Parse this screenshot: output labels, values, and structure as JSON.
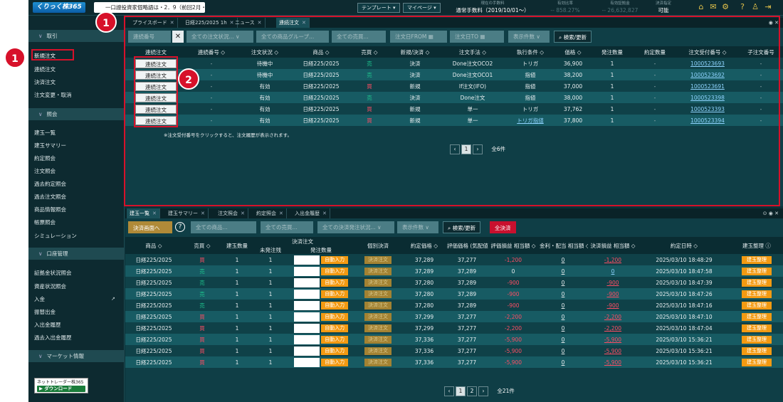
{
  "topbar": {
    "logo": "くりっく株365",
    "ticker": "一口證投資家個略語は・2．9（前回2月・1...",
    "template_label": "テンプレート ▾",
    "mypage_label": "マイページ ▾",
    "stats": [
      {
        "label": "現在の手数料",
        "value": "通常手数料（2019/10/01～）"
      },
      {
        "label": "有効比率",
        "value": "-- 858.27%"
      },
      {
        "label": "有効証拠金",
        "value": "-- 26,632,827"
      },
      {
        "label": "決済指定",
        "value": "可能"
      }
    ],
    "icons": [
      "home-icon",
      "mail-icon",
      "gear-icon",
      "help-icon",
      "user-icon",
      "logout-icon"
    ]
  },
  "sidebar": {
    "sections": [
      {
        "title": "取引",
        "items": [
          "新規注文",
          "連続注文",
          "決済注文",
          "注文変更・取消"
        ]
      },
      {
        "title": "照会",
        "items": [
          "建玉一覧",
          "建玉サマリー",
          "約定照会",
          "注文照会",
          "過去約定照会",
          "過去注文照会",
          "商品情報照会",
          "帳票照会",
          "シミュレーション"
        ]
      },
      {
        "title": "口座管理",
        "items": [
          "証拠金状況照会",
          "資産状況照会",
          "入金",
          "振替出金",
          "入出金履歴",
          "過去入出金履歴"
        ]
      },
      {
        "title": "マーケット情報",
        "items": []
      }
    ],
    "active_item": "新規注文",
    "download": {
      "label": "ネットトレーダー株365",
      "button": "ダウンロード"
    }
  },
  "panel1": {
    "tabs": [
      "プライスボード",
      "日経225/2025 1h",
      "ニュース",
      "連続注文"
    ],
    "selected_tab": 3,
    "filters": {
      "cont_no": "連続番号",
      "order_status": "全ての注文状況...",
      "product_group": "全ての商品グループ...",
      "side": "全ての売買...",
      "date_from": "注文日FROM",
      "date_to": "注文日TO",
      "display_count": "表示件数",
      "search": "検索/更新"
    },
    "columns": [
      "連続注文",
      "連続番号 ◇",
      "注文状況 ◇",
      "商品 ◇",
      "売買 ◇",
      "新規/決済 ◇",
      "注文手法 ◇",
      "執行条件 ◇",
      "価格 ◇",
      "発注数量",
      "約定数量",
      "注文受付番号 ◇",
      "子注文番号"
    ],
    "rows": [
      {
        "btn": "連続注文",
        "cont": "-",
        "status": "待機中",
        "product": "日経225/2025",
        "side": "売",
        "side_type": "sell",
        "kind": "決済",
        "method": "Done注文OCO2",
        "cond": "トリガ",
        "price": "36,900",
        "qty": "1",
        "filled": "-",
        "order_no": "1000523693",
        "child": "-"
      },
      {
        "btn": "連続注文",
        "cont": "-",
        "status": "待機中",
        "product": "日経225/2025",
        "side": "売",
        "side_type": "sell",
        "kind": "決済",
        "method": "Done注文OCO1",
        "cond": "指値",
        "price": "38,200",
        "qty": "1",
        "filled": "-",
        "order_no": "1000523692",
        "child": "-"
      },
      {
        "btn": "連続注文",
        "cont": "-",
        "status": "有効",
        "product": "日経225/2025",
        "side": "買",
        "side_type": "buy",
        "kind": "新規",
        "method": "If注文(IFO)",
        "cond": "指値",
        "price": "37,000",
        "qty": "1",
        "filled": "-",
        "order_no": "1000523691",
        "child": "-"
      },
      {
        "btn": "連続注文",
        "cont": "-",
        "status": "有効",
        "product": "日経225/2025",
        "side": "売",
        "side_type": "sell",
        "kind": "決済",
        "method": "Done注文",
        "cond": "指値",
        "price": "38,000",
        "qty": "1",
        "filled": "-",
        "order_no": "1000523398",
        "child": "-"
      },
      {
        "btn": "連続注文",
        "cont": "-",
        "status": "有効",
        "product": "日経225/2025",
        "side": "買",
        "side_type": "buy",
        "kind": "新規",
        "method": "単一",
        "cond": "トリガ",
        "price": "37,762",
        "qty": "1",
        "filled": "-",
        "order_no": "1000523393",
        "child": "-"
      },
      {
        "btn": "連続注文",
        "cont": "-",
        "status": "有効",
        "product": "日経225/2025",
        "side": "買",
        "side_type": "buy",
        "kind": "新規",
        "method": "単一",
        "cond": "トリガ指値",
        "price": "37,800",
        "qty": "1",
        "filled": "-",
        "order_no": "1000523394",
        "child": "-"
      }
    ],
    "note": "※注文受付番号をクリックすると、注文履歴が表示されます。",
    "pager": {
      "current": "1",
      "total": "全6件"
    }
  },
  "panel2": {
    "tabs": [
      "建玉一覧",
      "建玉サマリー",
      "注文照会",
      "約定照会",
      "入出金履歴"
    ],
    "selected_tab": 0,
    "filters": {
      "settle_screen": "決済画面へ",
      "product": "全ての商品...",
      "side": "全ての売買...",
      "settle_status": "全ての決済発注状況...",
      "display_count": "表示件数",
      "search": "検索/更新",
      "settle_all": "全決済"
    },
    "columns": [
      "商品 ◇",
      "売買 ◇",
      "建玉数量",
      "決済注文",
      "個別決済",
      "約定価格 ◇",
      "評価価格 (気配値) ◇",
      "評価損益 相当額 ◇",
      "金利・配当 相当額 ◇",
      "決済損益 相当額 ◇",
      "約定日時 ◇",
      "建玉整理 ⓘ"
    ],
    "subcolumns": [
      "未発注残",
      "発注数量"
    ],
    "rows": [
      {
        "product": "日経225/2025",
        "side": "買",
        "side_type": "buy",
        "qty": "1",
        "remain": "1",
        "auto": "自動入力",
        "settle": "決済注文",
        "price": "37,289",
        "eval": "37,277",
        "pl": "-1,200",
        "div": "0",
        "spl": "-1,200",
        "date": "2025/03/10 18:48:29",
        "org": "建玉整理"
      },
      {
        "product": "日経225/2025",
        "side": "売",
        "side_type": "sell",
        "qty": "1",
        "remain": "1",
        "auto": "自動入力",
        "settle": "決済注文",
        "price": "37,289",
        "eval": "37,289",
        "pl": "0",
        "div": "0",
        "spl": "0",
        "date": "2025/03/10 18:47:58",
        "org": "建玉整理"
      },
      {
        "product": "日経225/2025",
        "side": "売",
        "side_type": "sell",
        "qty": "1",
        "remain": "1",
        "auto": "自動入力",
        "settle": "決済注文",
        "price": "37,280",
        "eval": "37,289",
        "pl": "-900",
        "div": "0",
        "spl": "-900",
        "date": "2025/03/10 18:47:39",
        "org": "建玉整理"
      },
      {
        "product": "日経225/2025",
        "side": "売",
        "side_type": "sell",
        "qty": "1",
        "remain": "1",
        "auto": "自動入力",
        "settle": "決済注文",
        "price": "37,280",
        "eval": "37,289",
        "pl": "-900",
        "div": "0",
        "spl": "-900",
        "date": "2025/03/10 18:47:26",
        "org": "建玉整理"
      },
      {
        "product": "日経225/2025",
        "side": "売",
        "side_type": "sell",
        "qty": "1",
        "remain": "1",
        "auto": "自動入力",
        "settle": "決済注文",
        "price": "37,280",
        "eval": "37,289",
        "pl": "-900",
        "div": "0",
        "spl": "-900",
        "date": "2025/03/10 18:47:16",
        "org": "建玉整理"
      },
      {
        "product": "日経225/2025",
        "side": "買",
        "side_type": "buy",
        "qty": "1",
        "remain": "1",
        "auto": "自動入力",
        "settle": "決済注文",
        "price": "37,299",
        "eval": "37,277",
        "pl": "-2,200",
        "div": "0",
        "spl": "-2,200",
        "date": "2025/03/10 18:47:10",
        "org": "建玉整理"
      },
      {
        "product": "日経225/2025",
        "side": "買",
        "side_type": "buy",
        "qty": "1",
        "remain": "1",
        "auto": "自動入力",
        "settle": "決済注文",
        "price": "37,299",
        "eval": "37,277",
        "pl": "-2,200",
        "div": "0",
        "spl": "-2,200",
        "date": "2025/03/10 18:47:04",
        "org": "建玉整理"
      },
      {
        "product": "日経225/2025",
        "side": "買",
        "side_type": "buy",
        "qty": "1",
        "remain": "1",
        "auto": "自動入力",
        "settle": "決済注文",
        "price": "37,336",
        "eval": "37,277",
        "pl": "-5,900",
        "div": "0",
        "spl": "-5,900",
        "date": "2025/03/10 15:36:21",
        "org": "建玉整理"
      },
      {
        "product": "日経225/2025",
        "side": "買",
        "side_type": "buy",
        "qty": "1",
        "remain": "1",
        "auto": "自動入力",
        "settle": "決済注文",
        "price": "37,336",
        "eval": "37,277",
        "pl": "-5,900",
        "div": "0",
        "spl": "-5,900",
        "date": "2025/03/10 15:36:21",
        "org": "建玉整理"
      },
      {
        "product": "日経225/2025",
        "side": "買",
        "side_type": "buy",
        "qty": "1",
        "remain": "1",
        "auto": "自動入力",
        "settle": "決済注文",
        "price": "37,336",
        "eval": "37,277",
        "pl": "-5,900",
        "div": "0",
        "spl": "-5,900",
        "date": "2025/03/10 15:36:21",
        "org": "建玉整理"
      }
    ],
    "pager": {
      "pages": [
        "1",
        "2"
      ],
      "current": "1",
      "total": "全21件"
    }
  },
  "annotations": {
    "badge1": "1",
    "badge2": "2"
  },
  "colors": {
    "bg": "#0c3239",
    "accent_red": "#d7112a",
    "buy": "#ff4d64",
    "sell": "#1ec88f",
    "orange": "#f39a12"
  }
}
